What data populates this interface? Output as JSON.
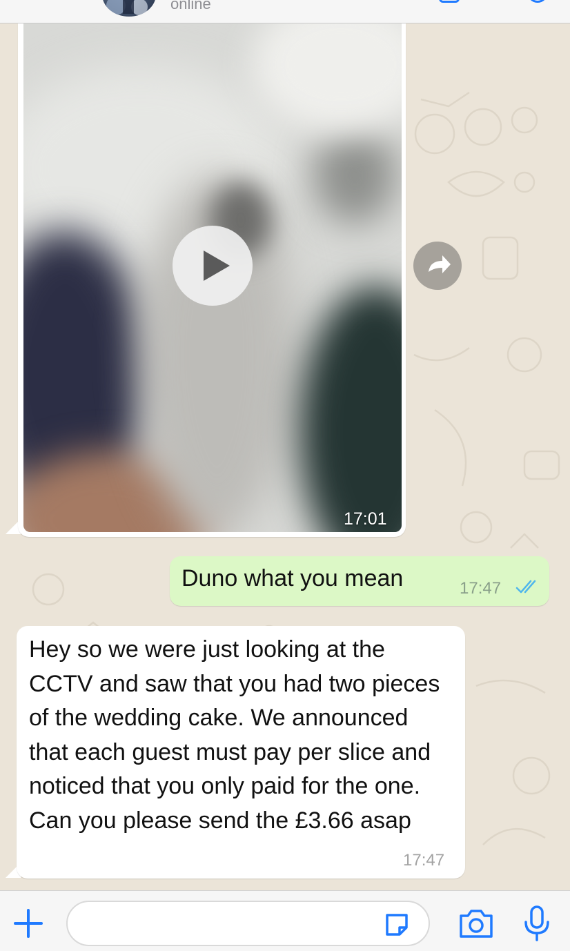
{
  "header": {
    "status": "online"
  },
  "messages": [
    {
      "type": "video",
      "direction": "incoming",
      "time": "17:01"
    },
    {
      "type": "text",
      "direction": "outgoing",
      "text": "Duno what you mean",
      "time": "17:47",
      "read": true
    },
    {
      "type": "text",
      "direction": "incoming",
      "text": "Hey so we were just looking at the CCTV and saw that you had two pieces of the wedding cake. We announced that each guest must pay per slice and noticed that you only paid for the one. Can you please send the £3.66 asap",
      "time": "17:47"
    }
  ],
  "composer": {
    "placeholder": "",
    "icons": [
      "plus-icon",
      "sticker-icon",
      "camera-icon",
      "microphone-icon"
    ]
  },
  "colors": {
    "accent": "#1f7aff",
    "outgoing_bubble": "#dcf8c6",
    "incoming_bubble": "#ffffff",
    "chat_background": "#ebe4d8",
    "read_ticks": "#4fb6ec"
  }
}
